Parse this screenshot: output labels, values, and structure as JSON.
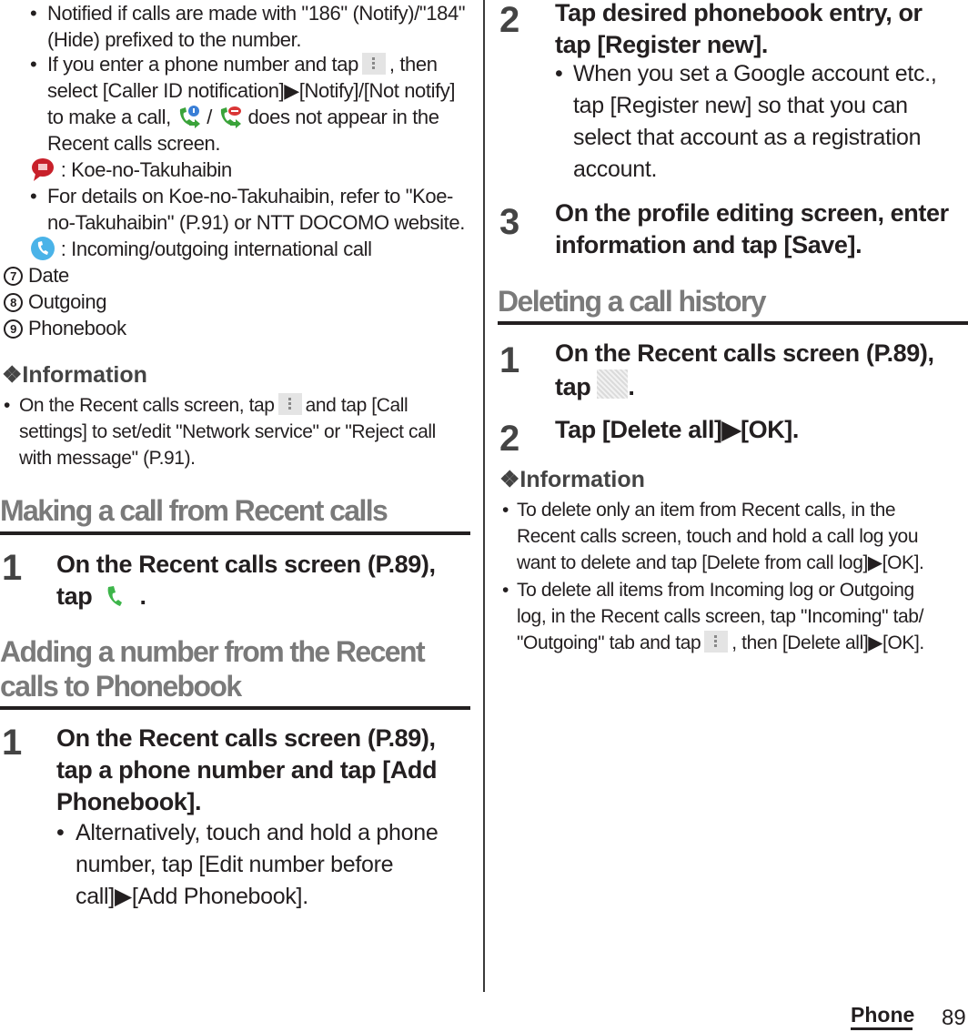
{
  "left": {
    "notes": [
      {
        "type": "bullet",
        "text_lines": [
          "Notified if calls are made with \"186\" (Notify)/\"184\"",
          "(Hide) prefixed to the number."
        ]
      },
      {
        "type": "bullet_complex",
        "line1_before": "If you enter a phone number and tap",
        "line1_after": ", then",
        "line2": "select [Caller ID notification]▶[Notify]/[Not notify]",
        "line3_before": "to make a call,",
        "line3_sep": "/",
        "line3_after": "does not appear in the",
        "line4": "Recent calls screen."
      },
      {
        "type": "icon_def",
        "icon": "koe-no-takuhaibin-icon",
        "text": ": Koe-no-Takuhaibin"
      },
      {
        "type": "bullet",
        "text_lines": [
          "For details on Koe-no-Takuhaibin, refer to \"Koe-",
          "no-Takuhaibin\" (P.91) or NTT DOCOMO website."
        ]
      },
      {
        "type": "icon_def",
        "icon": "international-call-icon",
        "text": ": Incoming/outgoing international call"
      }
    ],
    "numbered_items": [
      {
        "num": "7",
        "label": "Date"
      },
      {
        "num": "8",
        "label": "Outgoing"
      },
      {
        "num": "9",
        "label": "Phonebook"
      }
    ],
    "information": {
      "title": "❖Information",
      "line1_before": "On the Recent calls screen, tap",
      "line1_after": "and tap [Call",
      "line2": "settings] to set/edit \"Network service\" or \"Reject call",
      "line3": "with message\" (P.91)."
    },
    "section_making": {
      "title": "Making a call from Recent calls",
      "step1": {
        "num": "1",
        "line1": "On the Recent calls screen (P.89),",
        "line2_before": "tap",
        "line2_after": "."
      }
    },
    "section_adding": {
      "title_lines": [
        "Adding a number from the Recent",
        "calls to Phonebook"
      ],
      "step1": {
        "num": "1",
        "lines": [
          "On the Recent calls screen (P.89),",
          "tap a phone number and tap [Add",
          "Phonebook]."
        ],
        "bullet_lines": [
          "Alternatively, touch and hold a phone",
          "number, tap [Edit number before",
          "call]▶[Add Phonebook]."
        ]
      }
    }
  },
  "right": {
    "step2": {
      "num": "2",
      "lines": [
        "Tap desired phonebook entry, or",
        "tap [Register new]."
      ],
      "bullet_lines": [
        "When you set a Google account etc.,",
        "tap [Register new] so that you can",
        "select that account as a registration",
        "account."
      ]
    },
    "step3": {
      "num": "3",
      "lines": [
        "On the profile editing screen, enter",
        "information and tap [Save]."
      ]
    },
    "section_deleting": {
      "title": "Deleting a call history",
      "step1": {
        "num": "1",
        "line1": "On the Recent calls screen (P.89),",
        "line2_before": "tap",
        "line2_after": "."
      },
      "step2": {
        "num": "2",
        "text": "Tap [Delete all]▶[OK]."
      }
    },
    "information": {
      "title": "❖Information",
      "bullet1_lines": [
        "To delete only an item from Recent calls, in the",
        "Recent calls screen, touch and hold a call log you",
        "want to delete and tap [Delete from call log]▶[OK]."
      ],
      "bullet2_lines": [
        "To delete all items from Incoming log or Outgoing",
        "log, in the Recent calls screen, tap \"Incoming\" tab/"
      ],
      "bullet2_line3_before": "\"Outgoing\" tab and tap",
      "bullet2_line3_after": ", then [Delete all]▶[OK]."
    }
  },
  "footer": {
    "section": "Phone",
    "page": "89"
  },
  "bullet_char": "•"
}
